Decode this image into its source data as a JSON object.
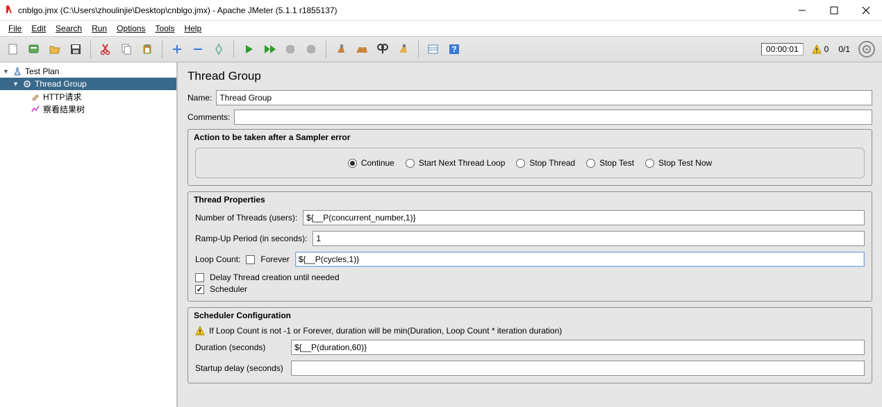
{
  "window": {
    "title": "cnblgo.jmx (C:\\Users\\zhoulinjie\\Desktop\\cnblgo.jmx) - Apache JMeter (5.1.1 r1855137)"
  },
  "menus": {
    "file": "File",
    "edit": "Edit",
    "search": "Search",
    "run": "Run",
    "options": "Options",
    "tools": "Tools",
    "help": "Help"
  },
  "status": {
    "time": "00:00:01",
    "warnings": "0",
    "threads": "0/1"
  },
  "tree": {
    "root": "Test Plan",
    "children": [
      {
        "label": "Thread Group",
        "selected": true,
        "children": [
          {
            "label": "HTTP请求"
          },
          {
            "label": "察看结果树"
          }
        ]
      }
    ]
  },
  "editor": {
    "heading": "Thread Group",
    "name_label": "Name:",
    "name_value": "Thread Group",
    "comments_label": "Comments:",
    "comments_value": "",
    "sampler_error": {
      "legend": "Action to be taken after a Sampler error",
      "options": {
        "continue": "Continue",
        "next_loop": "Start Next Thread Loop",
        "stop_thread": "Stop Thread",
        "stop_test": "Stop Test",
        "stop_test_now": "Stop Test Now"
      },
      "selected": "continue"
    },
    "thread_props": {
      "legend": "Thread Properties",
      "num_threads_label": "Number of Threads (users):",
      "num_threads_value": "${__P(concurrent_number,1)}",
      "ramp_label": "Ramp-Up Period (in seconds):",
      "ramp_value": "1",
      "loop_label": "Loop Count:",
      "forever_label": "Forever",
      "forever_checked": false,
      "loop_value": "${__P(cycles,1)}",
      "delay_create_label": "Delay Thread creation until needed",
      "delay_create_checked": false,
      "scheduler_label": "Scheduler",
      "scheduler_checked": true
    },
    "scheduler": {
      "legend": "Scheduler Configuration",
      "warn": "If Loop Count is not -1 or Forever, duration will be min(Duration, Loop Count * iteration duration)",
      "duration_label": "Duration (seconds)",
      "duration_value": "${__P(duration,60)}",
      "startup_label": "Startup delay (seconds)",
      "startup_value": ""
    }
  }
}
